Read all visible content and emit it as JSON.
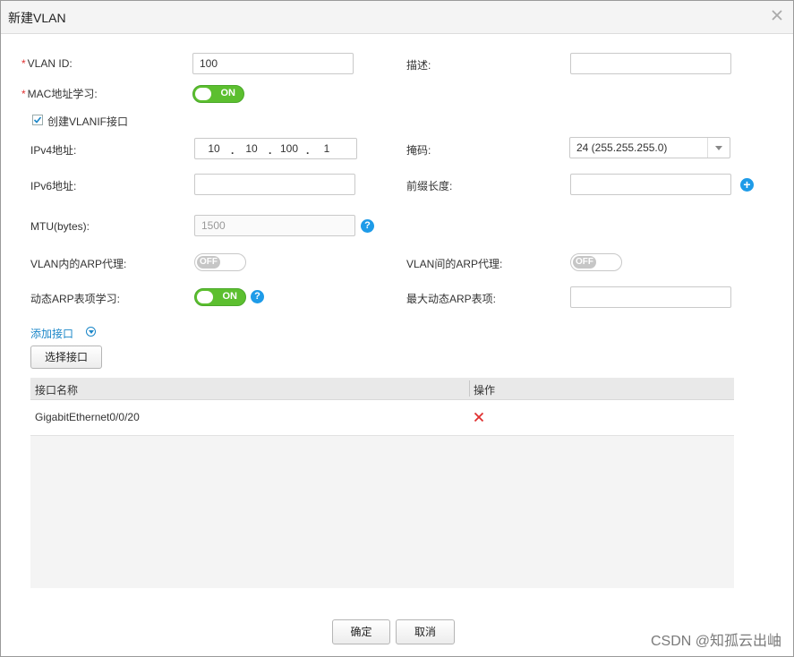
{
  "dialog": {
    "title": "新建VLAN"
  },
  "form": {
    "required_mark": "*",
    "vlan_id": {
      "label": "VLAN ID:",
      "value": "100"
    },
    "description": {
      "label": "描述:",
      "value": ""
    },
    "mac_learning": {
      "label": "MAC地址学习:",
      "state": "ON"
    },
    "create_vlanif": {
      "label": "创建VLANIF接口",
      "checked": true
    },
    "ipv4": {
      "label": "IPv4地址:",
      "octets": [
        "10",
        "10",
        "100",
        "1"
      ],
      "dot": "."
    },
    "mask": {
      "label": "掩码:",
      "value": "24 (255.255.255.0)"
    },
    "ipv6": {
      "label": "IPv6地址:",
      "value": ""
    },
    "prefix_length": {
      "label": "前缀长度:",
      "value": ""
    },
    "mtu": {
      "label": "MTU(bytes):",
      "placeholder": "1500"
    },
    "arp_proxy_intra": {
      "label": "VLAN内的ARP代理:",
      "state": "OFF"
    },
    "arp_proxy_inter": {
      "label": "VLAN间的ARP代理:",
      "state": "OFF"
    },
    "dynamic_arp_learning": {
      "label": "动态ARP表项学习:",
      "state": "ON"
    },
    "max_dynamic_arp": {
      "label": "最大动态ARP表项:",
      "value": ""
    },
    "help_glyph": "?",
    "plus_glyph": "+"
  },
  "ports": {
    "add_link": "添加接口",
    "select_button": "选择接口",
    "columns": [
      "接口名称",
      "操作"
    ],
    "rows": [
      {
        "name": "GigabitEthernet0/0/20"
      }
    ]
  },
  "footer": {
    "ok": "确定",
    "cancel": "取消"
  },
  "watermark": "CSDN @知孤云出岫",
  "colors": {
    "toggle_on": "#5cbf2f",
    "accent": "#1e9be8",
    "delete": "#e03030"
  },
  "icons": {
    "close": "close-icon",
    "help": "help-icon",
    "add": "plus-circle-icon",
    "delete": "delete-x-icon",
    "expand": "chevron-down-circle-icon",
    "check": "checkmark-icon"
  }
}
